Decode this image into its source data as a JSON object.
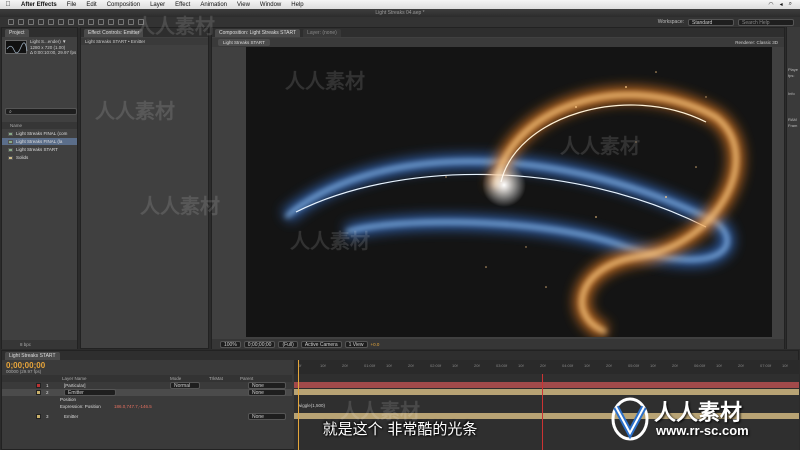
{
  "menubar": {
    "app": "After Effects",
    "items": [
      "File",
      "Edit",
      "Composition",
      "Layer",
      "Effect",
      "Animation",
      "View",
      "Window",
      "Help"
    ]
  },
  "window_title": "Light Streaks 04.aep *",
  "workspace": {
    "label": "Workspace:",
    "value": "Standard",
    "search_placeholder": "Search Help"
  },
  "project": {
    "tab": "Project",
    "comp_name": "Light S...ender) ▼",
    "comp_size": "1280 x 720 (1.00)",
    "comp_duration": "Δ 0:00:10:00, 29.97 fps",
    "column_name": "Name",
    "items": [
      "Light Streaks FINAL (com",
      "Light Streaks FINAL (la",
      "Light Streaks START",
      "Solids"
    ],
    "footer": "8 bpc"
  },
  "effects": {
    "tab": "Effect Controls: Emitter",
    "subtitle": "Light Streaks START • Emitter"
  },
  "comp": {
    "tab": "Composition: Light Streaks START",
    "tab2": "Layer: (none)",
    "subtab": "Light Streaks START",
    "renderer": "Renderer:  Classic 3D",
    "zoom": "100%",
    "timecode": "0;00;00;00",
    "resolution": "(Full)",
    "camera": "Active Camera",
    "views": "1 View",
    "exposure": "+0.0"
  },
  "info": [
    "Playe",
    "fps:",
    "Info",
    "RAM",
    "Fram"
  ],
  "timeline": {
    "tab": "Light Streaks START",
    "timecode": "0;00;00;00",
    "fps": "00000 (29.97 fps)",
    "col_layer": "Layer Name",
    "col_mode": "Mode",
    "col_trkmat": "TrkMat",
    "col_parent": "Parent",
    "layers": [
      {
        "num": "1",
        "name": "[Particular]",
        "mode": "Normal",
        "parent": "None"
      },
      {
        "num": "2",
        "name": "Emitter",
        "mode": "",
        "parent": "None"
      },
      {
        "num": "",
        "name": "Position",
        "mode": "",
        "parent": ""
      },
      {
        "num": "",
        "name": "Expression: Position",
        "mode": "",
        "parent": ""
      },
      {
        "num": "3",
        "name": "Emitter",
        "mode": "",
        "parent": "None"
      }
    ],
    "position_value": "186.0,747.7,-146.5",
    "expression": "wiggle(1,500)",
    "ticks": [
      "0f",
      "10f",
      "20f",
      "01:00f",
      "10f",
      "20f",
      "02:00f",
      "10f",
      "20f",
      "03:00f",
      "10f",
      "20f",
      "04:00f",
      "10f",
      "20f",
      "05:00f",
      "10f",
      "20f",
      "06:00f",
      "10f",
      "20f",
      "07:00f",
      "10f"
    ]
  },
  "subtitle": "就是这个 非常酷的光条",
  "logo": {
    "text": "人人素材",
    "url": "www.rr-sc.com"
  },
  "watermark": "人人素材"
}
